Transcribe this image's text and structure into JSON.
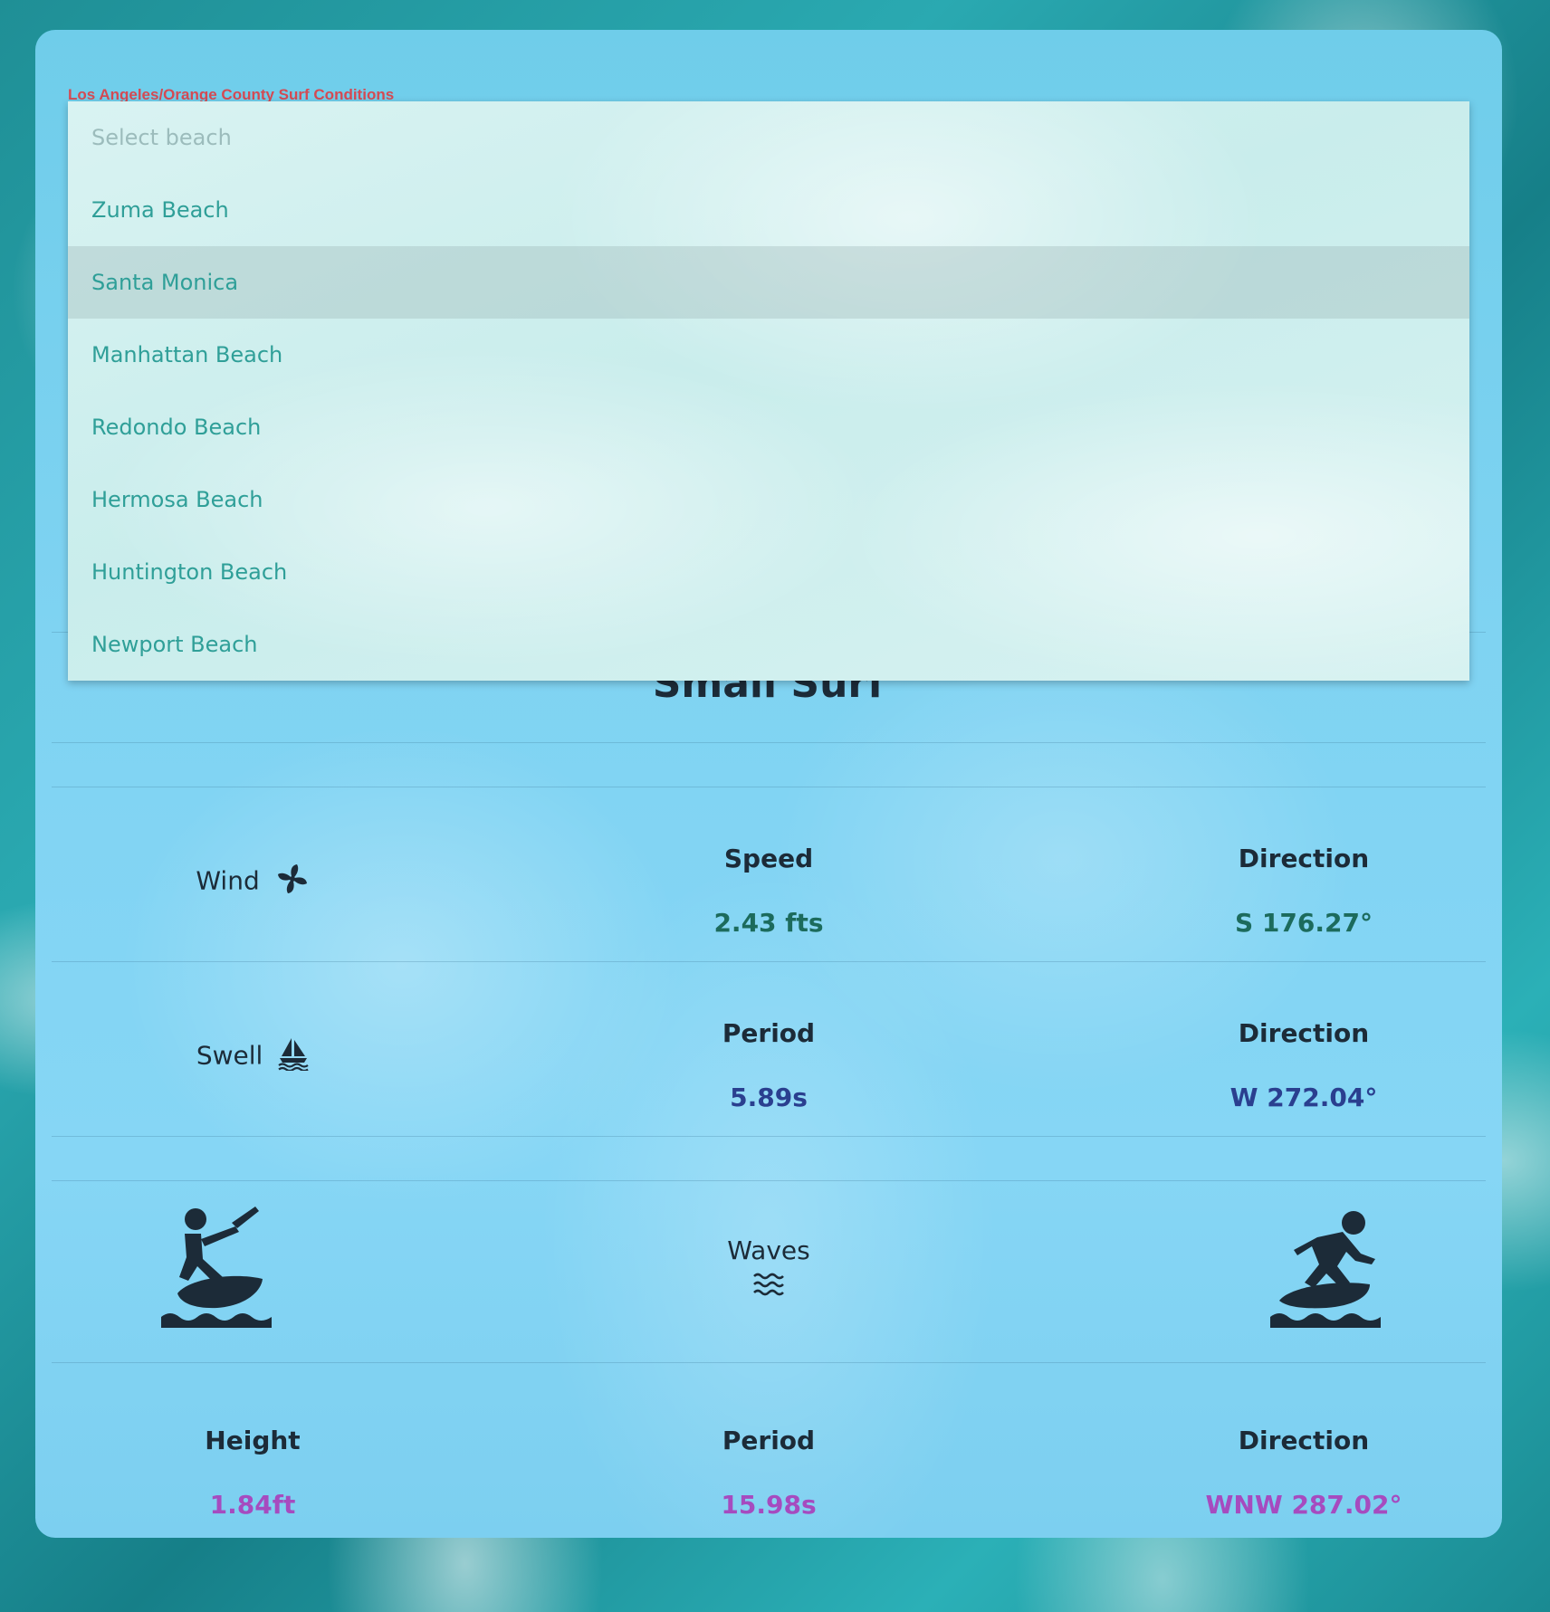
{
  "region_title": "Los Angeles/Orange County Surf Conditions",
  "beach_select": {
    "placeholder": "Select beach",
    "options": [
      "Zuma Beach",
      "Santa Monica",
      "Manhattan Beach",
      "Redondo Beach",
      "Hermosa Beach",
      "Huntington Beach",
      "Newport Beach"
    ],
    "highlighted": "Santa Monica"
  },
  "surf_status": "Small Surf",
  "wind": {
    "label": "Wind",
    "icon": "pinwheel-icon",
    "speed_label": "Speed",
    "speed_value": "2.43 fts",
    "direction_label": "Direction",
    "direction_value": "S 176.27°",
    "color": "#1c6b5c"
  },
  "swell": {
    "label": "Swell",
    "icon": "sailboat-icon",
    "period_label": "Period",
    "period_value": "5.89s",
    "direction_label": "Direction",
    "direction_value": "W 272.04°",
    "color": "#2a3f8f"
  },
  "waves": {
    "label": "Waves",
    "icon": "water-icon",
    "left_icon": "kitesurfer-icon",
    "right_icon": "surfer-icon",
    "height_label": "Height",
    "height_value": "1.84ft",
    "period_label": "Period",
    "period_value": "15.98s",
    "direction_label": "Direction",
    "direction_value": "WNW 287.02°",
    "color": "#a64bbf"
  }
}
